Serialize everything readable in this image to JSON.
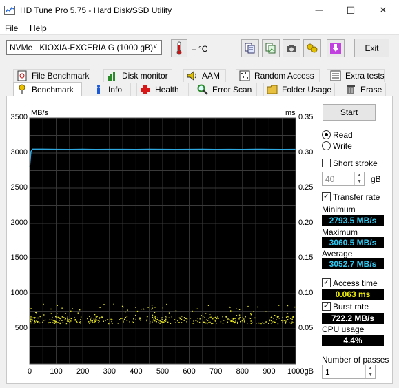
{
  "window": {
    "title": "HD Tune Pro 5.75 - Hard Disk/SSD Utility",
    "minimize": "—",
    "maximize": "☐",
    "close": "✕"
  },
  "menu": {
    "file": "File",
    "file_key": "F",
    "file_rest": "ile",
    "help": "Help",
    "help_key": "H",
    "help_rest": "elp"
  },
  "toolbar": {
    "drive_type": "NVMe",
    "drive_name": "KIOXIA-EXCERIA G (1000 gB)",
    "temperature": "– °C",
    "exit_label": "Exit"
  },
  "tabs_row1": [
    {
      "label": "File Benchmark",
      "icon": "file-benchmark-icon"
    },
    {
      "label": "Disk monitor",
      "icon": "disk-monitor-icon"
    },
    {
      "label": "AAM",
      "icon": "speaker-icon"
    },
    {
      "label": "Random Access",
      "icon": "random-access-icon"
    },
    {
      "label": "Extra tests",
      "icon": "extra-tests-icon"
    }
  ],
  "tabs_row2": [
    {
      "label": "Benchmark",
      "icon": "benchmark-icon"
    },
    {
      "label": "Info",
      "icon": "info-icon"
    },
    {
      "label": "Health",
      "icon": "health-cross-icon"
    },
    {
      "label": "Error Scan",
      "icon": "magnifier-icon"
    },
    {
      "label": "Folder Usage",
      "icon": "folder-icon"
    },
    {
      "label": "Erase",
      "icon": "trash-icon"
    }
  ],
  "panel": {
    "start_label": "Start",
    "read_label": "Read",
    "write_label": "Write",
    "mode": "read",
    "short_stroke_label": "Short stroke",
    "short_stroke_checked": false,
    "short_stroke_value": "40",
    "short_stroke_unit": "gB",
    "transfer_rate_label": "Transfer rate",
    "transfer_rate_checked": true,
    "minimum_label": "Minimum",
    "minimum_value": "2793.5 MB/s",
    "maximum_label": "Maximum",
    "maximum_value": "3060.5 MB/s",
    "average_label": "Average",
    "average_value": "3052.7 MB/s",
    "access_time_label": "Access time",
    "access_time_checked": true,
    "access_time_value": "0.063 ms",
    "burst_rate_label": "Burst rate",
    "burst_rate_checked": true,
    "burst_rate_value": "722.2 MB/s",
    "cpu_usage_label": "CPU usage",
    "cpu_usage_value": "4.4%",
    "passes_label": "Number of passes",
    "passes_value": "1"
  },
  "chart_data": {
    "type": "line",
    "y_left_unit": "MB/s",
    "y_right_unit": "ms",
    "x_unit": "gB",
    "x_ticks": [
      "0",
      "100",
      "200",
      "300",
      "400",
      "500",
      "600",
      "700",
      "800",
      "900",
      "1000gB"
    ],
    "y_left_ticks": [
      "3500",
      "3000",
      "2500",
      "2000",
      "1500",
      "1000",
      "500"
    ],
    "y_right_ticks": [
      "0.35",
      "0.30",
      "0.25",
      "0.20",
      "0.15",
      "0.10",
      "0.05"
    ],
    "xlim": [
      0,
      1000
    ],
    "ylim_left": [
      0,
      3500
    ],
    "ylim_right": [
      0,
      0.35
    ],
    "grid": true,
    "series": [
      {
        "name": "Transfer rate",
        "axis": "left",
        "color": "#2fa8e0",
        "x": [
          0,
          5,
          10,
          50,
          100,
          150,
          200,
          250,
          300,
          350,
          400,
          450,
          500,
          550,
          600,
          650,
          700,
          750,
          800,
          850,
          900,
          950,
          1000
        ],
        "values": [
          2793.5,
          3020,
          3055,
          3055,
          3053,
          3052,
          3054,
          3052,
          3053,
          3053,
          3052,
          3054,
          3053,
          3052,
          3053,
          3054,
          3052,
          3053,
          3052,
          3054,
          3053,
          3052,
          3053
        ]
      },
      {
        "name": "Access time",
        "axis": "right",
        "type": "scatter",
        "color": "#e8e820",
        "approx_range_ms": [
          0.055,
          0.085
        ],
        "mean_ms": 0.063
      }
    ]
  },
  "colors": {
    "plot_bg": "#000000",
    "grid": "#3a3a3a",
    "transfer": "#2fa8e0",
    "access": "#e8e820",
    "stat_cyan": "#2fc8f0",
    "stat_yellow": "#f0f000"
  }
}
